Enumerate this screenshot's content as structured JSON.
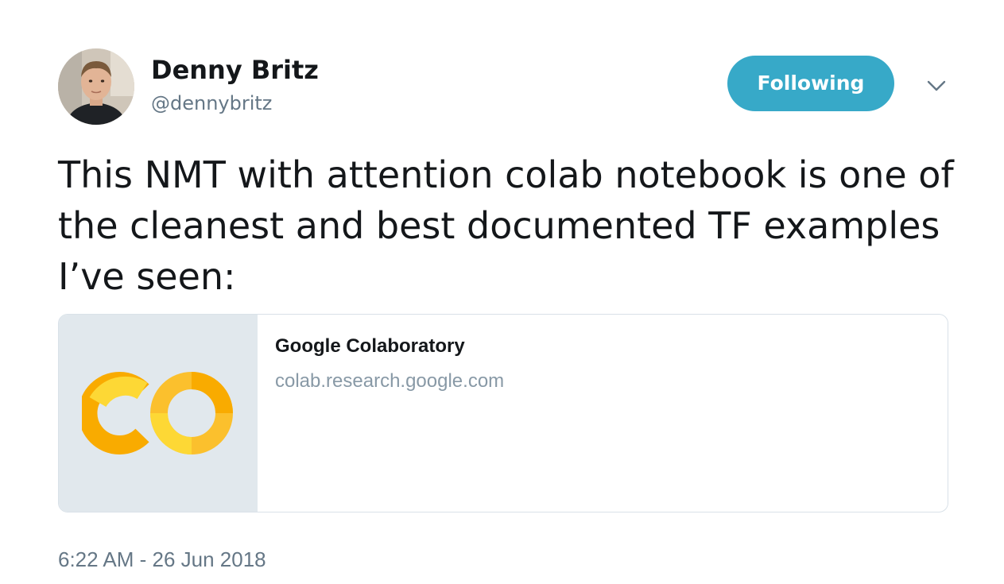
{
  "author": {
    "name": "Denny Britz",
    "handle": "@dennybritz",
    "avatar_icon": "profile-photo"
  },
  "follow_button": {
    "label": "Following",
    "color": "#37a9c8"
  },
  "menu": {
    "icon": "chevron-down-icon"
  },
  "tweet": {
    "text": "This NMT with attention colab notebook is one of the cleanest and best documented TF examples I’ve seen:"
  },
  "card": {
    "title": "Google Colaboratory",
    "url": "colab.research.google.com",
    "logo_icon": "colab-logo",
    "logo_colors": [
      "#f9ab00",
      "#fbc02d",
      "#fdd835"
    ],
    "media_background": "#e1e8ed"
  },
  "timestamp": "6:22 AM - 26 Jun 2018"
}
